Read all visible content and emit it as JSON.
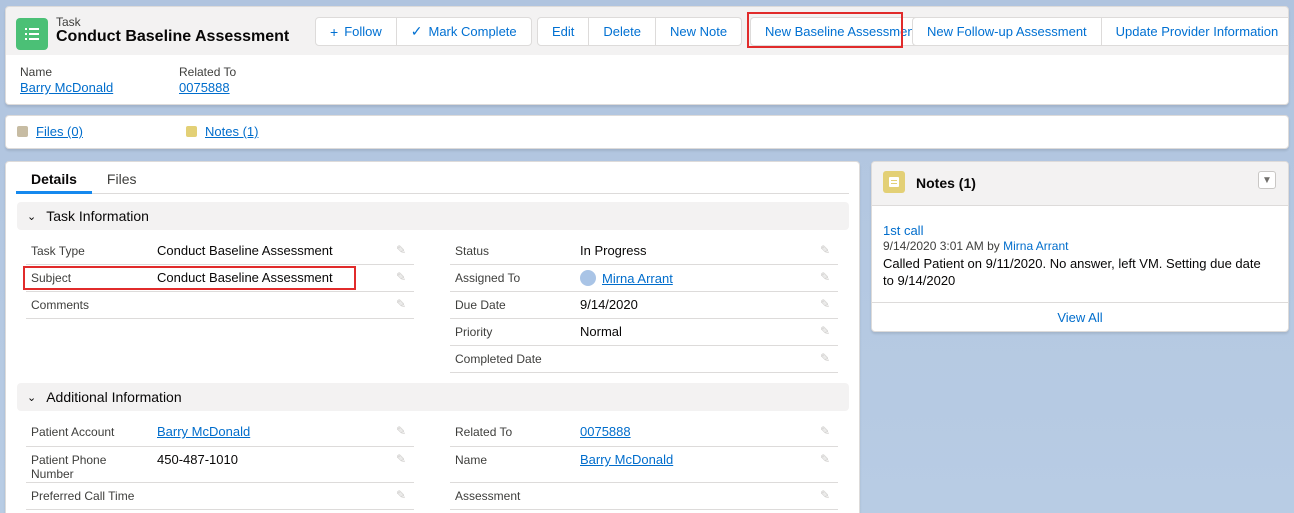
{
  "header": {
    "object_label": "Task",
    "title": "Conduct Baseline Assessment",
    "buttons": {
      "follow": "Follow",
      "mark_complete": "Mark Complete",
      "edit": "Edit",
      "delete": "Delete",
      "new_note": "New Note",
      "new_baseline": "New Baseline Assessment",
      "new_followup": "New Follow-up Assessment",
      "update_provider": "Update Provider Information"
    },
    "fields": {
      "name_label": "Name",
      "name_value": "Barry McDonald",
      "related_label": "Related To",
      "related_value": "0075888"
    }
  },
  "related_strip": {
    "files": "Files (0)",
    "notes": "Notes (1)"
  },
  "details": {
    "tabs": [
      "Details",
      "Files"
    ],
    "task_info": {
      "header": "Task Information",
      "left": [
        {
          "label": "Task Type",
          "value": "Conduct Baseline Assessment"
        },
        {
          "label": "Subject",
          "value": "Conduct Baseline Assessment"
        },
        {
          "label": "Comments",
          "value": ""
        }
      ],
      "right": [
        {
          "label": "Status",
          "value": "In Progress"
        },
        {
          "label": "Assigned To",
          "value": "Mirna Arrant"
        },
        {
          "label": "Due Date",
          "value": "9/14/2020"
        },
        {
          "label": "Priority",
          "value": "Normal"
        },
        {
          "label": "Completed Date",
          "value": ""
        }
      ]
    },
    "additional_info": {
      "header": "Additional Information",
      "left": [
        {
          "label": "Patient Account",
          "value": "Barry McDonald"
        },
        {
          "label": "Patient Phone Number",
          "value": "450-487-1010"
        },
        {
          "label": "Preferred Call Time",
          "value": ""
        }
      ],
      "right": [
        {
          "label": "Related To",
          "value": "0075888"
        },
        {
          "label": "Name",
          "value": "Barry McDonald"
        },
        {
          "label": "Assessment",
          "value": ""
        }
      ]
    }
  },
  "notes_panel": {
    "title": "Notes (1)",
    "note_title": "1st call",
    "note_meta_prefix": "9/14/2020 3:01 AM by",
    "note_author": "Mirna Arrant",
    "note_body": "Called Patient on 9/11/2020. No answer, left VM. Setting due date to 9/14/2020",
    "view_all": "View All"
  },
  "colors": {
    "accent": "#0070d2",
    "link": "#006dcc",
    "highlight": "#e12b2b",
    "task_icon": "#4bc076",
    "notes_icon": "#e3d076"
  }
}
